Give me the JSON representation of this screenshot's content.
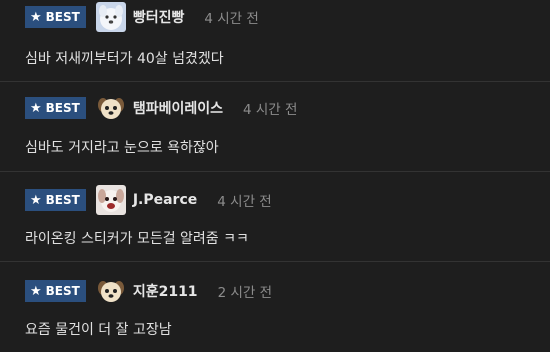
{
  "comments": [
    {
      "badge": "BEST",
      "avatar": "white-dog-avatar",
      "nickname": "빵터진빵",
      "time": "4 시간 전",
      "text": "심바 저새끼부터가 40살 넘겼겠다"
    },
    {
      "badge": "BEST",
      "avatar": "puppy-avatar",
      "nickname": "탬파베이레이스",
      "time": "4 시간 전",
      "text": "심바도 거지라고 눈으로 욕하잖아"
    },
    {
      "badge": "BEST",
      "avatar": "dog-face-avatar",
      "nickname": "J.Pearce",
      "time": "4 시간 전",
      "text": "라이온킹 스티커가 모든걸 알려줌 ㅋㅋ"
    },
    {
      "badge": "BEST",
      "avatar": "puppy-avatar",
      "nickname": "지훈2111",
      "time": "2 시간 전",
      "text": "요즘 물건이 더 잘 고장남"
    }
  ],
  "colors": {
    "background": "#1e1e1e",
    "badge": "#2b4f7e",
    "divider": "#333333",
    "time": "#8c8c8c"
  }
}
